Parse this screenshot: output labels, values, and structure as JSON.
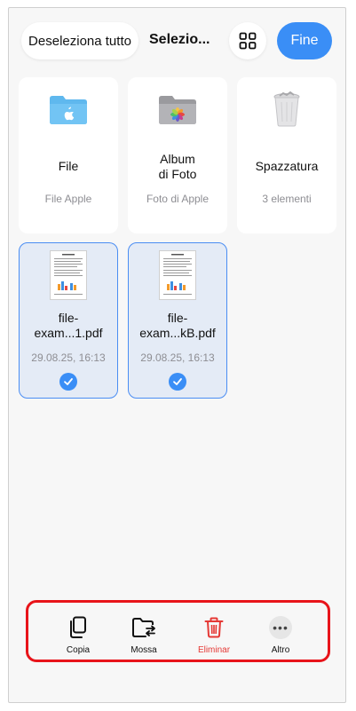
{
  "header": {
    "deselect_label": "Deseleziona tutto",
    "title": "Selezio...",
    "done_label": "Fine"
  },
  "items": [
    {
      "title": "File",
      "subtitle": "File Apple",
      "icon": "folder-icon"
    },
    {
      "title": "Album\ndi Foto",
      "subtitle": "Foto di Apple",
      "icon": "photos-folder-icon"
    },
    {
      "title": "Spazzatura",
      "subtitle": "3 elementi",
      "icon": "trash-bin-icon"
    },
    {
      "title": "file-\nexam...1.pdf",
      "subtitle": "29.08.25, 16:13",
      "icon": "pdf-thumbnail",
      "selected": true
    },
    {
      "title": "file-\nexam...kB.pdf",
      "subtitle": "29.08.25, 16:13",
      "icon": "pdf-thumbnail",
      "selected": true
    }
  ],
  "toolbar": {
    "copy_label": "Copia",
    "move_label": "Mossa",
    "delete_label": "Eliminar",
    "more_label": "Altro"
  },
  "colors": {
    "accent": "#3a8ef6",
    "danger": "#e53935",
    "highlight_border": "#e8141a"
  }
}
